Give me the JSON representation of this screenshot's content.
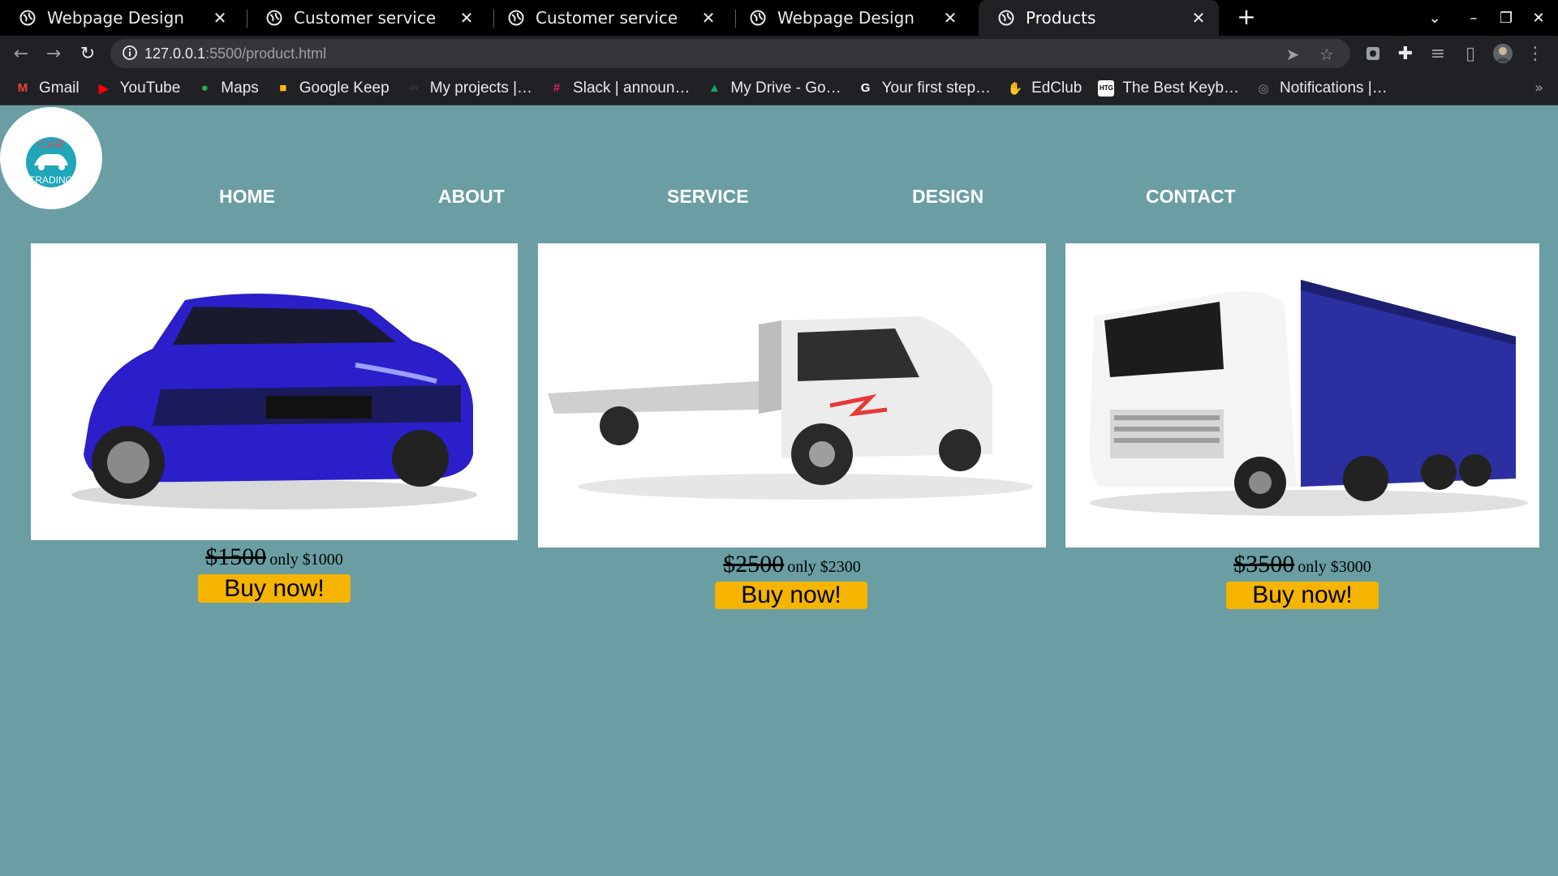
{
  "browser": {
    "tabs": [
      {
        "title": "Webpage Design",
        "active": false
      },
      {
        "title": "Customer service",
        "active": false
      },
      {
        "title": "Customer service",
        "active": false
      },
      {
        "title": "Webpage Design",
        "active": false
      },
      {
        "title": "Products",
        "active": true
      }
    ],
    "url_host": "127.0.0.1",
    "url_rest": ":5500/product.html",
    "bookmarks": [
      {
        "label": "Gmail",
        "icon": "gmail-icon",
        "color": "#ea4335",
        "glyph": "M"
      },
      {
        "label": "YouTube",
        "icon": "youtube-icon",
        "color": "#ff0000",
        "glyph": "▶"
      },
      {
        "label": "Maps",
        "icon": "maps-icon",
        "color": "#34a853",
        "glyph": "●"
      },
      {
        "label": "Google Keep",
        "icon": "keep-icon",
        "color": "#fbbc04",
        "glyph": "■"
      },
      {
        "label": "My projects |…",
        "icon": "olx-icon",
        "color": "#3c4043",
        "glyph": "olx"
      },
      {
        "label": "Slack | announ…",
        "icon": "slack-icon",
        "color": "#e01e5a",
        "glyph": "#"
      },
      {
        "label": "My Drive - Go…",
        "icon": "drive-icon",
        "color": "#1fa463",
        "glyph": "▲"
      },
      {
        "label": "Your first step…",
        "icon": "google-icon",
        "color": "#ffffff",
        "glyph": "G"
      },
      {
        "label": "EdClub",
        "icon": "edclub-icon",
        "color": "#f29900",
        "glyph": "✋"
      },
      {
        "label": "The Best Keyb…",
        "icon": "htg-icon",
        "color": "#000000",
        "glyph": "HTG"
      },
      {
        "label": "Notifications |…",
        "icon": "globe-icon",
        "color": "#5f6368",
        "glyph": "◎"
      }
    ]
  },
  "site": {
    "logo_top": "CAR",
    "logo_bottom": "TRADING",
    "nav": [
      "HOME",
      "ABOUT",
      "SERVICE",
      "DESIGN",
      "CONTACT"
    ],
    "products": [
      {
        "name": "blue-sedan",
        "old_price": "$1500",
        "new_price": "only $1000",
        "button": "Buy now!",
        "color": "#2a1fc9"
      },
      {
        "name": "white-flatbed-truck",
        "old_price": "$2500",
        "new_price": "only $2300",
        "button": "Buy now!",
        "color": "#e8e8e8"
      },
      {
        "name": "semi-truck-trailer",
        "old_price": "$3500",
        "new_price": "only $3000",
        "button": "Buy now!",
        "color": "#2b2fa0"
      }
    ]
  },
  "colors": {
    "page_bg": "#6a9ea3",
    "button": "#f4b400"
  }
}
